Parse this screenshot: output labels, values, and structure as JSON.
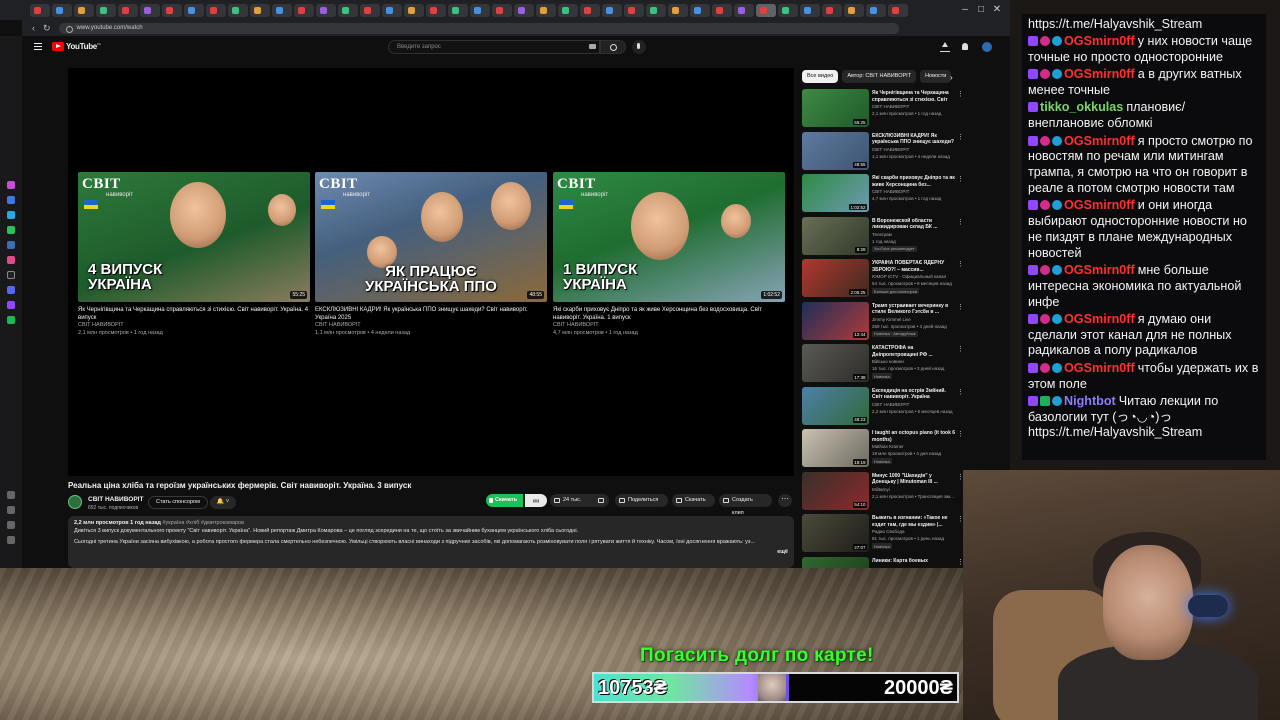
{
  "browser": {
    "url": "www.youtube.com/watch",
    "tab_colors": [
      "#e04040",
      "#4a90e2",
      "#e0a040",
      "#40c080",
      "#e04040",
      "#9a5fe0",
      "#e04040",
      "#4a90e2",
      "#e04040",
      "#40c080",
      "#e0a040",
      "#4a90e2",
      "#e04040",
      "#9a5fe0",
      "#40c080",
      "#e04040",
      "#4a90e2",
      "#e0a040",
      "#e04040",
      "#40c080",
      "#4a90e2",
      "#e04040",
      "#9a5fe0",
      "#e0a040",
      "#40c080",
      "#e04040",
      "#4a90e2",
      "#e04040",
      "#40c080",
      "#e0a040",
      "#4a90e2",
      "#e04040",
      "#9a5fe0",
      "#e04040",
      "#40c080",
      "#4a90e2",
      "#e04040",
      "#e0a040",
      "#4a90e2",
      "#e04040"
    ]
  },
  "youtube": {
    "search_placeholder": "Введите запрос",
    "end_cards": [
      {
        "overlay": "4 ВИПУСК\nУКРАЇНА",
        "duration": "55:25",
        "title": "Як Чернігівщина та Черкащина справляються зі стихією. Світ навиворіт. Україна. 4 випуск",
        "channel": "СВІТ НАВИВОРІТ",
        "meta": "2,1 млн просмотров • 1 год назад"
      },
      {
        "overlay": "ЯК ПРАЦЮЄ\nУКРАЇНСЬКА ППО",
        "duration": "48:55",
        "title": "ЕКСКЛЮЗИВНІ КАДРИ! Як українська ППО знищує шахеди? Світ навиворіт. Україна 2025",
        "channel": "СВІТ НАВИВОРІТ",
        "meta": "1,1 млн просмотров • 4 недели назад"
      },
      {
        "overlay": "1 ВИПУСК\nУКРАЇНА",
        "duration": "1:02:52",
        "title": "Які скарби приховує Дніпро та як живе Херсонщина без водосховища. Світ навиворіт. Україна. 1 випуск",
        "channel": "СВІТ НАВИВОРІТ",
        "meta": "4,7 млн просмотров • 1 год назад"
      }
    ],
    "brand_name": "СВІТ",
    "brand_sub": "навиворіт",
    "video_title": "Реальна ціна хліба та героїзм українських фермерів. Світ навиворіт. Україна. 3 випуск",
    "channel_name": "СВІТ НАВИВОРІТ",
    "subscribers": "892 тыс. подписчиков",
    "sponsor_label": "Стать спонсором",
    "download_app_label": "Скачать",
    "likes": "24 тыс.",
    "share_label": "Поделиться",
    "download_label": "Скачать",
    "clip_label": "Создать клип",
    "desc_meta": "2,2 млн просмотров  1 год назад",
    "desc_tags": "#україна #хліб #дмитрокомаров",
    "desc_line1": "Дивіться 3 випуск документального проекту \"Світ навиворіт. Україна\". Новий репортаж Дмитра Комарова – це погляд зсередини на те, що стоїть за звичайним буханцем українського хліба сьогодні.",
    "desc_line2": "Сьогодні третина України засіяна вибухівкою, а робота простого фермера стала смертельно небезпечною. Умільці створюють власні винаходи з підручних засобів, які допомагають розміновувати поля і рятувати життя й техніку. Часом, їхні досягнення вражають: уз...",
    "desc_more": "ещё",
    "chips": [
      "Все видео",
      "Автор: СВІТ НАВИВОРІТ",
      "Новости"
    ],
    "recommendations": [
      {
        "title": "Як Чернігівщина та Черкащина справляються зі стихією. Світ навиворіт.",
        "channel": "СВІТ НАВИВОРІТ",
        "views": "2,1 млн просмотров • 1 год назад",
        "badge": "",
        "duration": "55:25",
        "thumb": [
          "#3e8a45",
          "#1f5a2a"
        ]
      },
      {
        "title": "ЕКСКЛЮЗИВНІ КАДРИ! Як українська ППО знищує шахеди?",
        "channel": "СВІТ НАВИВОРІТ",
        "views": "1,1 млн просмотров • 4 недели назад",
        "badge": "",
        "duration": "48:55",
        "thumb": [
          "#5e7aa0",
          "#3e5470"
        ]
      },
      {
        "title": "Які скарби приховує Дніпро та як живе Херсонщина без...",
        "channel": "СВІТ НАВИВОРІТ",
        "views": "4,7 млн просмотров • 1 год назад",
        "badge": "",
        "duration": "1:02:52",
        "thumb": [
          "#2f8a44",
          "#6d9ab2"
        ]
      },
      {
        "title": "В Воронежской области ликвидирован склад БК ...",
        "channel": "Телеграм",
        "views": "1 год назад",
        "badge": "YouTube рекомендует",
        "duration": "8:28",
        "thumb": [
          "#6a6f55",
          "#2f3a2a"
        ]
      },
      {
        "title": "УКРАЇНА ПОВЕРТАЄ ЯДЕРНУ ЗБРОЮ?! – массив...",
        "channel": "ЮМОР ICTV · Официальный канал",
        "views": "54 тыс. просмотров • 9 месяцев назад",
        "badge": "Больше для спонсоров",
        "duration": "2:05:25",
        "thumb": [
          "#b2382e",
          "#3d2a20"
        ]
      },
      {
        "title": "Трамп устраивает вечеринку в стиле Великого Гэтсби в ...",
        "channel": "Jimmy Kimmel Live",
        "views": "269 тыс. просмотров • 3 дней назад",
        "badge": "Новинка · Автодубляж",
        "duration": "12:44",
        "thumb": [
          "#1e2f5a",
          "#b03a3a"
        ]
      },
      {
        "title": "КАТАСТРОФА на Дніпропетровщині РФ ...",
        "channel": "Військо новини",
        "views": "16 тыс. просмотров • 3 дней назад",
        "badge": "Новинка",
        "duration": "17:38",
        "thumb": [
          "#5a5a55",
          "#2e2c28"
        ]
      },
      {
        "title": "Експедиція на острів Зміїний. Світ навиворіт. Україна",
        "channel": "СВІТ НАВИВОРІТ",
        "views": "2,2 млн просмотров • 6 месяцев назад",
        "badge": "",
        "duration": "48:23",
        "thumb": [
          "#4f7fa8",
          "#2f6a3a"
        ]
      },
      {
        "title": "I taught an octopus piano (it took 6 months)",
        "channel": "Mathias Kramer",
        "views": "19 млн просмотров • 4 дня назад",
        "badge": "Новинка",
        "duration": "19:19",
        "thumb": [
          "#c9c2b2",
          "#6d6a60"
        ]
      },
      {
        "title": "Минус 1000 \"Шахидів\" у Донецьку | Minutoman III ...",
        "channel": "Militarnyi",
        "views": "2,1 млн просмотров • Трансляция зак...",
        "badge": "",
        "duration": "54:10",
        "thumb": [
          "#3a2f2a",
          "#8a2a2a"
        ]
      },
      {
        "title": "Выжить в изгнании: «Такое не ездит там, где мы ездим» |...",
        "channel": "Радио Свобода",
        "views": "81 тыс. просмотров • 1 день назад",
        "badge": "Новинка",
        "duration": "27:07",
        "thumb": [
          "#4a4a3a",
          "#1e1e1a"
        ]
      },
      {
        "title": "Линики: Карта боевых",
        "channel": "",
        "views": "",
        "badge": "",
        "duration": "",
        "thumb": [
          "#2f6a2f",
          "#1a3a1a"
        ]
      }
    ]
  },
  "chat": {
    "messages": [
      {
        "badges": [],
        "nick": "",
        "nick_color": "#ffffff",
        "text": "https://t.me/Halyavshik_Stream"
      },
      {
        "badges": [
          "tw",
          "heart",
          "blue"
        ],
        "nick": "OGSmirn0ff",
        "nick_color": "#ff2f2f",
        "text": "у них новости чаще точные но просто односторонние"
      },
      {
        "badges": [
          "tw",
          "heart",
          "blue"
        ],
        "nick": "OGSmirn0ff",
        "nick_color": "#ff2f2f",
        "text": "а в других ватных менее точные"
      },
      {
        "badges": [
          "tw"
        ],
        "nick": "tikko_okkulas",
        "nick_color": "#7bd36a",
        "text": "плановиє/внеплановиє обломкі"
      },
      {
        "badges": [
          "tw",
          "heart",
          "blue"
        ],
        "nick": "OGSmirn0ff",
        "nick_color": "#ff2f2f",
        "text": "я просто смотрю по новостям по речам или митингам трампа, я смотрю на что он говорит в реале а потом смотрю новости там"
      },
      {
        "badges": [
          "tw",
          "heart",
          "blue"
        ],
        "nick": "OGSmirn0ff",
        "nick_color": "#ff2f2f",
        "text": "и они иногда выбирают односторонние новости но не пиздят в плане международных новостей"
      },
      {
        "badges": [
          "tw",
          "heart",
          "blue"
        ],
        "nick": "OGSmirn0ff",
        "nick_color": "#ff2f2f",
        "text": "мне больше интересна экономика по актуальной инфе"
      },
      {
        "badges": [
          "tw",
          "heart",
          "blue"
        ],
        "nick": "OGSmirn0ff",
        "nick_color": "#ff2f2f",
        "text": "я думаю они сделали этот канал для не полных радикалов а полу радикалов"
      },
      {
        "badges": [
          "tw",
          "heart",
          "blue"
        ],
        "nick": "OGSmirn0ff",
        "nick_color": "#ff2f2f",
        "text": "чтобы удержать их в этом поле"
      },
      {
        "badges": [
          "tw",
          "green",
          "blue"
        ],
        "nick": "Nightbot",
        "nick_color": "#8a7dff",
        "text": "Читаю лекции по базологии тут (っ◔◡◔)っ https://t.me/Halyavshik_Stream"
      }
    ]
  },
  "donation": {
    "label": "Погасить долг по карте!",
    "current": "10753₴",
    "goal": "20000₴",
    "progress": 0.5377
  }
}
